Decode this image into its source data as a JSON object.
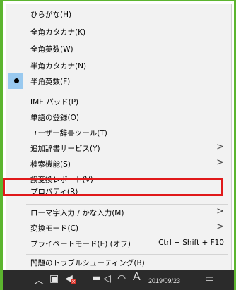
{
  "menu": {
    "items": [
      {
        "label": "ひらがな(H)"
      },
      {
        "label": "全角カタカナ(K)"
      },
      {
        "label": "全角英数(W)"
      },
      {
        "label": "半角カタカナ(N)"
      },
      {
        "label": "半角英数(F)"
      },
      {
        "label": "IME パッド(P)"
      },
      {
        "label": "単語の登録(O)"
      },
      {
        "label": "ユーザー辞書ツール(T)"
      },
      {
        "label": "追加辞書サービス(Y)"
      },
      {
        "label": "検索機能(S)"
      },
      {
        "label": "誤変換レポート(V)"
      },
      {
        "label": "プロパティ(R)"
      },
      {
        "label": "ローマ字入力 / かな入力(M)"
      },
      {
        "label": "変換モード(C)"
      },
      {
        "label": "プライベートモード(E) (オフ)",
        "shortcut": "Ctrl + Shift + F10"
      },
      {
        "label": "問題のトラブルシューティング(B)"
      }
    ],
    "selected_mode": "半角英数(F)",
    "submenu_arrow": ">"
  },
  "taskbar": {
    "date": "2019/09/23",
    "ime_indicator": "A"
  },
  "colors": {
    "highlight_box": "#e0191a",
    "selected_bg": "#99c9ef",
    "green_border": "#5cb52f"
  }
}
